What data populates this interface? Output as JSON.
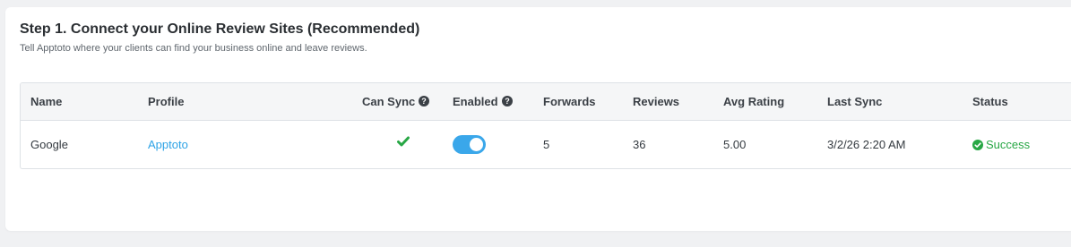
{
  "step": {
    "title": "Step 1. Connect your Online Review Sites (Recommended)",
    "subtitle": "Tell Apptoto where your clients can find your business online and leave reviews."
  },
  "table": {
    "columns": {
      "name": "Name",
      "profile": "Profile",
      "can_sync": "Can Sync",
      "enabled": "Enabled",
      "forwards": "Forwards",
      "reviews": "Reviews",
      "avg_rating": "Avg Rating",
      "last_sync": "Last Sync",
      "status": "Status"
    },
    "rows": [
      {
        "name": "Google",
        "profile": "Apptoto",
        "can_sync": true,
        "enabled": true,
        "forwards": "5",
        "reviews": "36",
        "avg_rating": "5.00",
        "last_sync": "3/2/26 2:20 AM",
        "status": "Success"
      }
    ]
  },
  "icons": {
    "help": "question-circle-icon",
    "can_sync": "check-icon",
    "status": "check-circle-icon"
  },
  "colors": {
    "link": "#2ea3e6",
    "toggle_on": "#3aa7ea",
    "success": "#28a745"
  }
}
